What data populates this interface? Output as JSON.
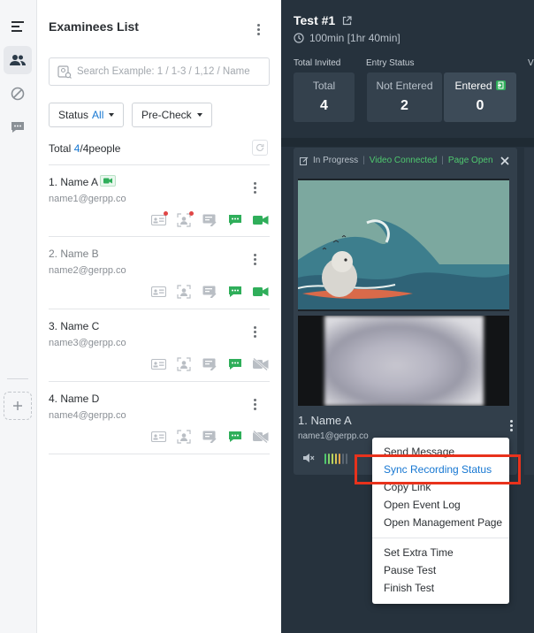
{
  "rail": {
    "items": [
      "list-icon",
      "people-icon",
      "block-icon",
      "chat-icon"
    ],
    "add_icon": "plus-icon"
  },
  "list": {
    "title": "Examinees List",
    "search_placeholder": "Search Example: 1 / 1-3 / 1,12 / Name",
    "status_label": "Status",
    "status_value": "All",
    "precheck_label": "Pre-Check",
    "total_prefix": "Total",
    "total_shown": "4",
    "total_sep": "/",
    "total_all": "4people",
    "examinees": [
      {
        "name": "1. Name A",
        "email": "name1@gerpp.co"
      },
      {
        "name": "2. Name B",
        "email": "name2@gerpp.co"
      },
      {
        "name": "3. Name C",
        "email": "name3@gerpp.co"
      },
      {
        "name": "4. Name D",
        "email": "name4@gerpp.co"
      }
    ]
  },
  "test": {
    "title": "Test #1",
    "duration": "100min [1hr 40min]",
    "total_invited_label": "Total Invited",
    "entry_status_label": "Entry Status",
    "edge_label": "V",
    "total_label": "Total",
    "total_value": "4",
    "not_entered_label": "Not Entered",
    "not_entered_value": "2",
    "entered_label": "Entered",
    "entered_value": "0"
  },
  "card": {
    "status_in_progress": "In Progress",
    "status_video": "Video Connected",
    "status_page": "Page Open",
    "separator": "|",
    "name": "1. Name A",
    "email": "name1@gerpp.co",
    "level_colors": [
      "#4fc86f",
      "#7fd06a",
      "#b8d45c",
      "#d9c655",
      "#e6a54b",
      "#5a6672",
      "#5a6672"
    ]
  },
  "menu": {
    "items": [
      "Send Message",
      "Sync Recording Status",
      "Copy Link",
      "Open Event Log",
      "Open Management Page"
    ],
    "items2": [
      "Set Extra Time",
      "Pause Test",
      "Finish Test"
    ],
    "highlighted": "Sync Recording Status",
    "highlight_color": "#e8321c"
  },
  "colors": {
    "accent": "#1677d2",
    "green": "#2fae5a",
    "panel": "#26323d"
  }
}
